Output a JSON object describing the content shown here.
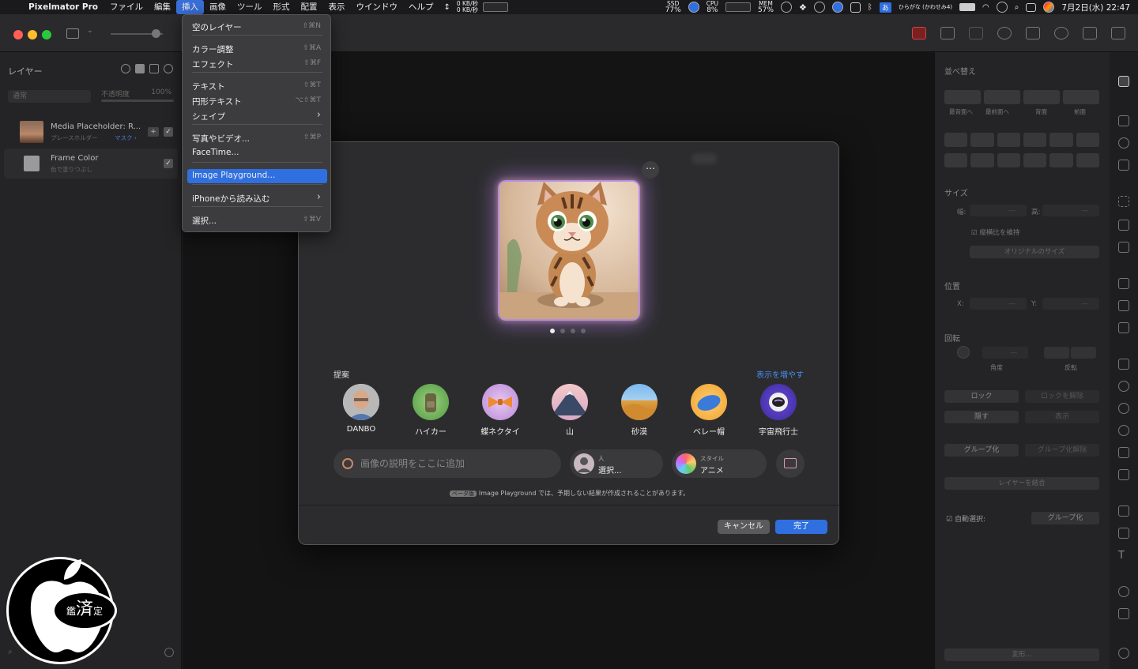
{
  "menubar": {
    "app_name": "Pixelmator Pro",
    "items": [
      "ファイル",
      "編集",
      "挿入",
      "画像",
      "ツール",
      "形式",
      "配置",
      "表示",
      "ウインドウ",
      "ヘルプ"
    ],
    "active_index": 2,
    "status": {
      "net_up": "0 KB/秒",
      "net_down": "0 KB/秒",
      "ssd_label": "SSD",
      "ssd_value": "77%",
      "cpu_label": "CPU",
      "cpu_value": "8%",
      "mem_label": "MEM",
      "mem_value": "57%",
      "input_mode": "あ",
      "input_name": "ひらがな (かわせみ4)",
      "clock": "7月2日(水) 22:47"
    }
  },
  "insert_menu": {
    "items": [
      {
        "label": "空のレイヤー",
        "shortcut": "⇧⌘N"
      },
      {
        "label": "カラー調整",
        "shortcut": "⇧⌘A"
      },
      {
        "label": "エフェクト",
        "shortcut": "⇧⌘F"
      },
      {
        "label": "テキスト",
        "shortcut": "⇧⌘T"
      },
      {
        "label": "円形テキスト",
        "shortcut": "⌥⇧⌘T"
      },
      {
        "label": "シェイプ",
        "shortcut": "›"
      },
      {
        "label": "写真やビデオ...",
        "shortcut": "⇧⌘P"
      },
      {
        "label": "FaceTime...",
        "shortcut": ""
      },
      {
        "label": "Image Playground...",
        "shortcut": ""
      },
      {
        "label": "iPhoneから読み込む",
        "shortcut": "›"
      },
      {
        "label": "選択...",
        "shortcut": "⇧⌘V"
      }
    ],
    "highlighted_index": 8
  },
  "layers_panel": {
    "title": "レイヤー",
    "blend_mode": "通常",
    "opacity_label": "不透明度",
    "opacity_value": "100%",
    "layers": [
      {
        "name": "Media Placeholder: R...",
        "sub": "プレースホルダー",
        "sub2": "マスク ›"
      },
      {
        "name": "Frame Color",
        "sub": "色で塗りつぶし",
        "sub2": ""
      }
    ]
  },
  "arrange_panel": {
    "title": "並べ替え",
    "order_buttons": [
      "最背面へ",
      "最前面へ",
      "背面",
      "前面"
    ],
    "size_title": "サイズ",
    "width_label": "幅:",
    "height_label": "高:",
    "field_placeholder": "---",
    "keep_ratio": "縦横比を維持",
    "original_size": "オリジナルのサイズ",
    "position_title": "位置",
    "x_label": "X:",
    "y_label": "Y:",
    "rotation_title": "回転",
    "angle_label": "角度",
    "flip_label": "反転",
    "lock": "ロック",
    "unlock": "ロックを解除",
    "hide": "隠す",
    "show": "表示",
    "group": "グループ化",
    "ungroup": "グループ化解除",
    "merge": "レイヤーを結合",
    "auto_select_label": "自動選択:",
    "auto_select_value": "グループ化",
    "transform": "変形..."
  },
  "playground": {
    "suggestions_label": "提案",
    "show_more": "表示を増やす",
    "suggestions": [
      {
        "label": "DANBO",
        "icon": "person-photo-icon"
      },
      {
        "label": "ハイカー",
        "icon": "backpack-icon"
      },
      {
        "label": "蝶ネクタイ",
        "icon": "bowtie-icon"
      },
      {
        "label": "山",
        "icon": "mountain-icon"
      },
      {
        "label": "砂漠",
        "icon": "desert-icon"
      },
      {
        "label": "ベレー帽",
        "icon": "beret-icon"
      },
      {
        "label": "宇宙飛行士",
        "icon": "astronaut-icon"
      }
    ],
    "prompt_placeholder": "画像の説明をここに追加",
    "person_label": "人",
    "person_value": "選択...",
    "style_label": "スタイル",
    "style_value": "アニメ",
    "beta": "ベータ版",
    "disclaimer": "Image Playground では、予期しない結果が作成されることがあります。",
    "cancel": "キャンセル",
    "done": "完了",
    "page_count": 4,
    "page_index": 0
  },
  "watermark": {
    "text": "鑑済定"
  },
  "colors": {
    "accent": "#2f6fe0",
    "link": "#4a8cf0",
    "glow": "#b78ce0"
  }
}
